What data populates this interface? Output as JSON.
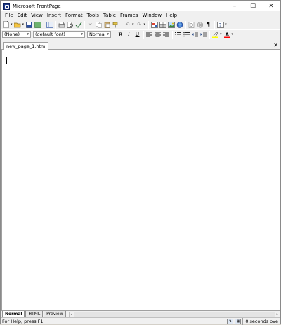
{
  "window": {
    "title": "Microsoft FrontPage"
  },
  "menubar": {
    "items": [
      "File",
      "Edit",
      "View",
      "Insert",
      "Format",
      "Tools",
      "Table",
      "Frames",
      "Window",
      "Help"
    ]
  },
  "toolbar_format": {
    "style_value": "(None)",
    "font_value": "(default font)",
    "size_value": "Normal"
  },
  "document": {
    "tab_label": "new_page_1.htm"
  },
  "view_tabs": [
    "Normal",
    "HTML",
    "Preview"
  ],
  "status": {
    "help_text": "For Help, press F1",
    "time_text": "0 seconds ove"
  },
  "icons": [
    "new-icon",
    "open-icon",
    "save-icon",
    "publish-icon",
    "folder-list-icon",
    "print-icon",
    "print-preview-icon",
    "spelling-icon",
    "cut-icon",
    "copy-icon",
    "paste-icon",
    "format-painter-icon",
    "undo-icon",
    "redo-icon",
    "insert-component-icon",
    "insert-table-icon",
    "insert-picture-icon",
    "hyperlink-icon",
    "refresh-icon",
    "stop-icon",
    "show-all-icon",
    "help-icon"
  ],
  "colors": {
    "highlight": "#ffff00",
    "font_color": "#ff0000"
  }
}
